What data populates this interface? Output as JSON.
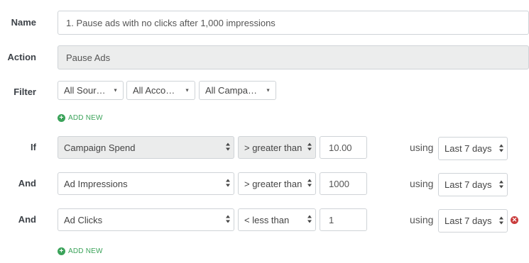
{
  "name": {
    "label": "Name",
    "value": "1. Pause ads with no clicks after 1,000 impressions"
  },
  "action": {
    "label": "Action",
    "value": "Pause Ads"
  },
  "filter": {
    "label": "Filter",
    "selects": [
      "All Sour…",
      "All Acco…",
      "All Campa…"
    ],
    "add_new": "ADD NEW"
  },
  "conditions": [
    {
      "label": "If",
      "metric": "Campaign Spend",
      "operator": "> greater than",
      "value": "10.00",
      "using": "using",
      "period": "Last 7 days"
    },
    {
      "label": "And",
      "metric": "Ad Impressions",
      "operator": "> greater than",
      "value": "1000",
      "using": "using",
      "period": "Last 7 days"
    },
    {
      "label": "And",
      "metric": "Ad Clicks",
      "operator": "< less than",
      "value": "1",
      "using": "using",
      "period": "Last 7 days"
    }
  ],
  "conditions_add_new": "ADD NEW",
  "icons": {
    "add": "plus-circle-icon",
    "remove": "remove-circle-icon"
  },
  "colors": {
    "accent_green": "#3ba35a",
    "remove_red": "#c93b3b"
  }
}
